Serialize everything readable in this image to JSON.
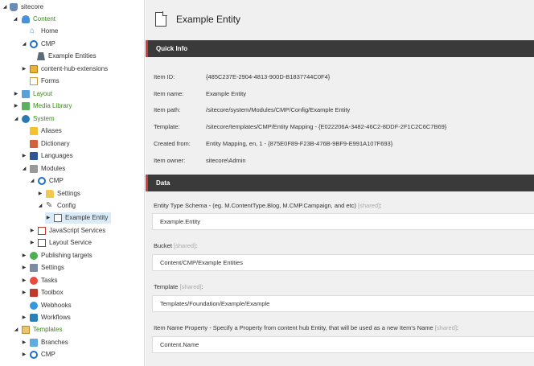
{
  "tree": {
    "root": "sitecore",
    "content": "Content",
    "home": "Home",
    "cmp": "CMP",
    "example_entities": "Example Entities",
    "content_hub_extensions": "content-hub-extensions",
    "forms": "Forms",
    "layout": "Layout",
    "media_library": "Media Library",
    "system": "System",
    "aliases": "Aliases",
    "dictionary": "Dictionary",
    "languages": "Languages",
    "modules": "Modules",
    "modules_cmp": "CMP",
    "settings_folder": "Settings",
    "config": "Config",
    "example_entity": "Example Entity",
    "javascript_services": "JavaScript Services",
    "layout_service": "Layout Service",
    "publishing_targets": "Publishing targets",
    "system_settings": "Settings",
    "tasks": "Tasks",
    "toolbox": "Toolbox",
    "webhooks": "Webhooks",
    "workflows": "Workflows",
    "templates": "Templates",
    "branches": "Branches",
    "templates_cmp": "CMP"
  },
  "header": {
    "title": "Example Entity"
  },
  "quick_info": {
    "section_title": "Quick Info",
    "item_id_label": "Item ID:",
    "item_id": "{485C237E-2904-4813-900D-B1837744C0F4}",
    "item_name_label": "Item name:",
    "item_name": "Example Entity",
    "item_path_label": "Item path:",
    "item_path": "/sitecore/system/Modules/CMP/Config/Example Entity",
    "template_label": "Template:",
    "template": "/sitecore/templates/CMP/Entity Mapping - {E022206A-3482-46C2-8DDF-2F1C2C6C7B69}",
    "created_from_label": "Created from:",
    "created_from": "Entity Mapping, en, 1 - {875E0F89-F23B-476B-9BF9-E991A107F693}",
    "item_owner_label": "Item owner:",
    "item_owner": "sitecore\\Admin"
  },
  "data": {
    "section_title": "Data",
    "shared_tag": "[shared]",
    "entity_type_schema_label": "Entity Type Schema - (eg. M.ContentType.Blog, M.CMP.Campaign, and etc)",
    "entity_type_schema_value": "Example.Entity",
    "bucket_label": "Bucket",
    "bucket_value": "Content/CMP/Example Entities",
    "template_label": "Template",
    "template_value": "Templates/Foundation/Example/Example",
    "item_name_property_label": "Item Name Property - Specify a Property from content hub Entity, that will be used as a new Item's Name",
    "item_name_property_value": "Content.Name"
  },
  "colors": {
    "section_bar": "#3a3a3a",
    "section_accent": "#d63b3b",
    "tree_green": "#3a8a1a",
    "selected_bg": "#d9ebf9"
  }
}
